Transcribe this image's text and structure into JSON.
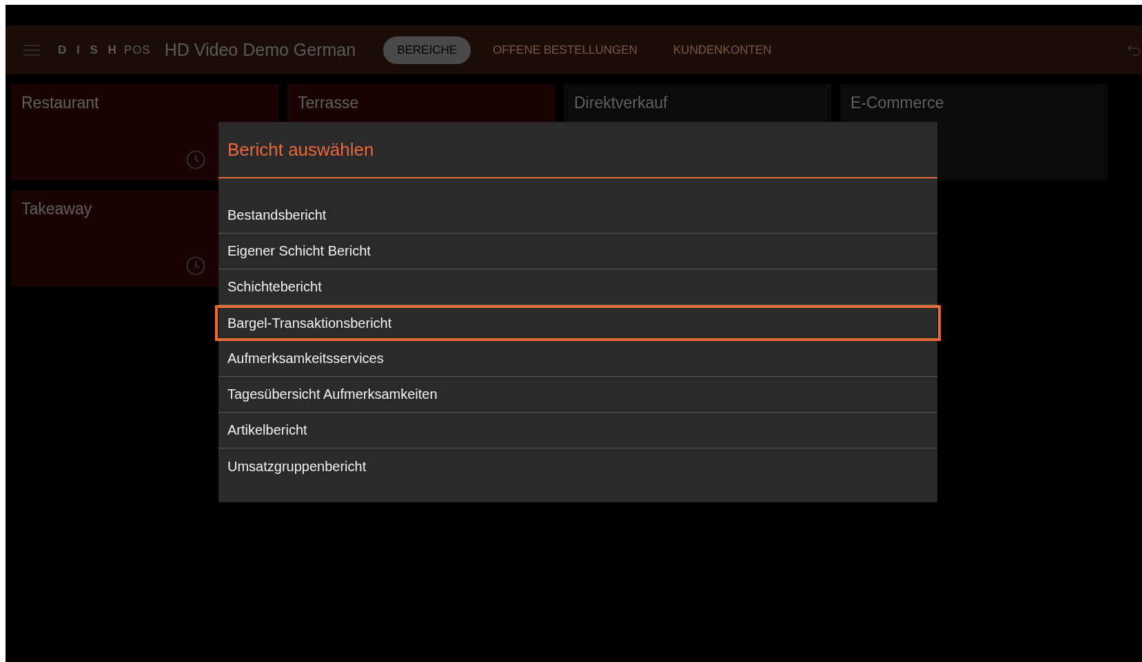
{
  "app_bar": {
    "logo_mark": "D I S H",
    "logo_suffix": "POS",
    "title": "HD Video Demo German",
    "tabs": [
      {
        "label": "BEREICHE",
        "selected": true
      },
      {
        "label": "OFFENE BESTELLUNGEN",
        "selected": false
      },
      {
        "label": "KUNDENKONTEN",
        "selected": false
      }
    ]
  },
  "areas": [
    {
      "name": "Restaurant",
      "color": "#190303",
      "timer": true
    },
    {
      "name": "Terrasse",
      "color": "#190303",
      "timer": false
    },
    {
      "name": "Direktverkauf",
      "color": "#0b0b0b",
      "timer": false
    },
    {
      "name": "E-Commerce",
      "color": "#0b0b0b",
      "timer": false
    },
    {
      "name": "Takeaway",
      "color": "#190303",
      "timer": true
    }
  ],
  "dialog": {
    "title": "Bericht auswählen",
    "items": [
      {
        "label": "Bestandsbericht",
        "selected": false
      },
      {
        "label": "Eigener Schicht Bericht",
        "selected": false
      },
      {
        "label": "Schichtebericht",
        "selected": false
      },
      {
        "label": "Bargel-Transaktionsbericht",
        "selected": true
      },
      {
        "label": "Aufmerksamkeitsservices",
        "selected": false
      },
      {
        "label": "Tagesübersicht Aufmerksamkeiten",
        "selected": false
      },
      {
        "label": "Artikelbericht",
        "selected": false
      },
      {
        "label": "Umsatzgruppenbericht",
        "selected": false
      }
    ]
  }
}
